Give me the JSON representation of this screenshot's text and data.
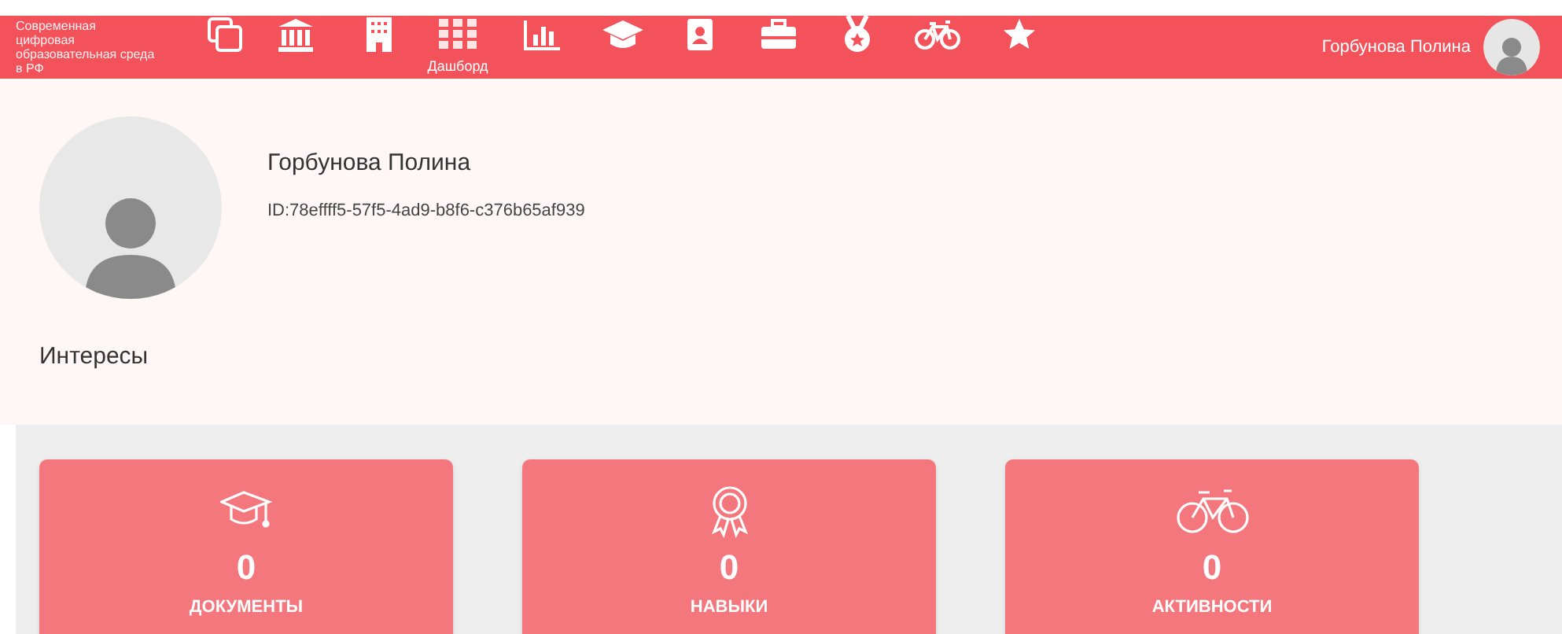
{
  "header": {
    "logo_text": "Современная цифровая образовательная среда в РФ",
    "nav_items": [
      {
        "kind": "icon"
      },
      {
        "kind": "icon"
      },
      {
        "kind": "icon"
      },
      {
        "kind": "labeled",
        "label": "Дашборд"
      },
      {
        "kind": "icon"
      },
      {
        "kind": "icon"
      },
      {
        "kind": "icon"
      },
      {
        "kind": "icon"
      },
      {
        "kind": "icon"
      },
      {
        "kind": "icon"
      },
      {
        "kind": "icon"
      }
    ],
    "user_name": "Горбунова Полина"
  },
  "profile": {
    "name": "Горбунова Полина",
    "id": "ID:78effff5-57f5-4ad9-b8f6-c376b65af939",
    "interests_title": "Интересы"
  },
  "cards": [
    {
      "value": "0",
      "label": "ДОКУМЕНТЫ"
    },
    {
      "value": "0",
      "label": "НАВЫКИ"
    },
    {
      "value": "0",
      "label": "АКТИВНОСТИ"
    }
  ]
}
